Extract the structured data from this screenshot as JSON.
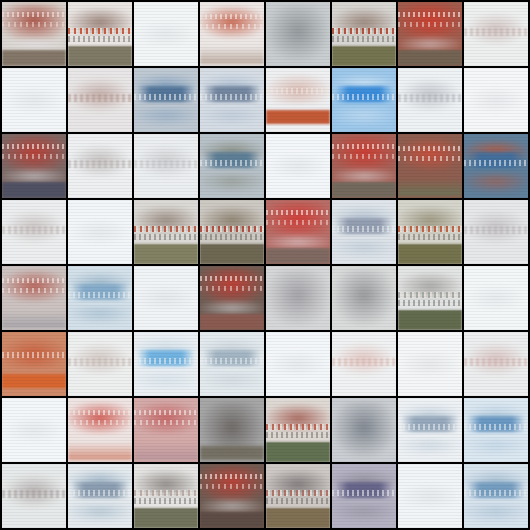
{
  "grid": {
    "rows": 8,
    "cols": 8,
    "tiles": [
      {
        "style": "red-dark",
        "bg": "#d9d4cf",
        "blob": "#a84c3e",
        "band": "#7b6d5e"
      },
      {
        "style": "strip",
        "bg": "#e9e5e2",
        "blob": "#8a6f64",
        "band": "#7a7560",
        "accent": "#c84a2e"
      },
      {
        "style": "white",
        "bg": "#f3f6f7"
      },
      {
        "style": "red",
        "bg": "#ece7e5",
        "blob": "#c5573e",
        "band": "#b9a89b"
      },
      {
        "style": "gray",
        "bg": "#c9ced0",
        "blob": "#8a8f93"
      },
      {
        "style": "strip",
        "bg": "#d8d6d2",
        "blob": "#8d766a",
        "band": "#6f6f4a",
        "accent": "#b23f2b"
      },
      {
        "style": "red-dark",
        "bg": "#9f5d4e",
        "blob": "#d03d2f",
        "band": "#6e6454"
      },
      {
        "style": "pale",
        "bg": "#eef0f0",
        "blob": "#c7b4b1"
      },
      {
        "style": "white",
        "bg": "#f2f6f8"
      },
      {
        "style": "pale",
        "bg": "#e8e6e6",
        "blob": "#b79a93"
      },
      {
        "style": "blue",
        "bg": "#bfc9d3",
        "blob": "#4b6f95",
        "band": "#8aa6c2"
      },
      {
        "style": "blue",
        "bg": "#d6dde5",
        "blob": "#6b7f9a",
        "band": "#b3c3d6"
      },
      {
        "style": "orange",
        "bg": "#eef0f2",
        "blob": "#d8b3a8",
        "band": "#c1522e"
      },
      {
        "style": "blue",
        "bg": "#9cc7ea",
        "blob": "#2f86d8",
        "band": "#cfe5f6"
      },
      {
        "style": "pale",
        "bg": "#eef2f4",
        "blob": "#b4b6bd"
      },
      {
        "style": "white",
        "bg": "#f5f7f8"
      },
      {
        "style": "red-dark",
        "bg": "#7c6a67",
        "blob": "#bf3c33",
        "band": "#4c4f63"
      },
      {
        "style": "pale",
        "bg": "#eef0f2",
        "blob": "#b7b1ae"
      },
      {
        "style": "pale",
        "bg": "#eceff1",
        "blob": "#c4c4c7"
      },
      {
        "style": "blue",
        "bg": "#b8c2c9",
        "blob": "#567a94",
        "band": "#8a8f84"
      },
      {
        "style": "white",
        "bg": "#f4f7f9"
      },
      {
        "style": "red-dark",
        "bg": "#a56359",
        "blob": "#cf3a30",
        "band": "#6e6a5e"
      },
      {
        "style": "red",
        "bg": "#8e5e50",
        "blob": "#cf4d3a",
        "band": "#6a765a"
      },
      {
        "style": "blue",
        "bg": "#5f7f9b",
        "blob": "#3e6fa0",
        "band": "#b55a40"
      },
      {
        "style": "pale",
        "bg": "#eceeef",
        "blob": "#c0b7b5"
      },
      {
        "style": "white",
        "bg": "#f3f6f8"
      },
      {
        "style": "strip",
        "bg": "#dcdad6",
        "blob": "#8d7d72",
        "band": "#7e7d5d",
        "accent": "#b9513b"
      },
      {
        "style": "strip",
        "bg": "#cdc9c3",
        "blob": "#7f735f",
        "band": "#69634d",
        "accent": "#b33f31"
      },
      {
        "style": "red-dark",
        "bg": "#b86f69",
        "blob": "#d33b35",
        "band": "#7a6961"
      },
      {
        "style": "blue",
        "bg": "#dfe5ea",
        "blob": "#8d98ad",
        "band": "#b6c4d3"
      },
      {
        "style": "strip",
        "bg": "#d6d5cc",
        "blob": "#8f8a70",
        "band": "#6f6e47",
        "accent": "#c25533"
      },
      {
        "style": "pale",
        "bg": "#e6e8ea",
        "blob": "#bcb7bb"
      },
      {
        "style": "red",
        "bg": "#ccc3c1",
        "blob": "#b4574c",
        "band": "#a4a1a8"
      },
      {
        "style": "blue",
        "bg": "#d4e1ea",
        "blob": "#7fa8c8",
        "band": "#9db8cc"
      },
      {
        "style": "white",
        "bg": "#f1f4f6"
      },
      {
        "style": "red-dark",
        "bg": "#6f5e55",
        "blob": "#c63d34",
        "band": "#8d5b51"
      },
      {
        "style": "gray",
        "bg": "#d6d7d8",
        "blob": "#9a9a9f"
      },
      {
        "style": "gray",
        "bg": "#dadcdc",
        "blob": "#8d8e91"
      },
      {
        "style": "strip",
        "bg": "#e3e5e4",
        "blob": "#9d9b98",
        "band": "#5d6547",
        "accent": "#a2a7a3"
      },
      {
        "style": "white",
        "bg": "#f4f7f8"
      },
      {
        "style": "orange",
        "bg": "#cf8a6a",
        "blob": "#c85a39",
        "band": "#d8642d"
      },
      {
        "style": "pale",
        "bg": "#eef0f0",
        "blob": "#c9bbb4"
      },
      {
        "style": "blue",
        "bg": "#eaf0f4",
        "blob": "#65aee0",
        "band": "#cfdce6"
      },
      {
        "style": "blue",
        "bg": "#e4ebef",
        "blob": "#9eb1c0",
        "band": "#c9d3da"
      },
      {
        "style": "white",
        "bg": "#f4f7f9"
      },
      {
        "style": "pale",
        "bg": "#f0f2f3",
        "blob": "#ddb9b2"
      },
      {
        "style": "white",
        "bg": "#f4f6f7"
      },
      {
        "style": "pale",
        "bg": "#eceeef",
        "blob": "#d2b4b0"
      },
      {
        "style": "white",
        "bg": "#f3f7f9"
      },
      {
        "style": "red",
        "bg": "#eee4e2",
        "blob": "#ce4c43",
        "band": "#d58b76"
      },
      {
        "style": "red",
        "bg": "#d4aba9",
        "blob": "#c45d5e",
        "band": "#b7949a"
      },
      {
        "style": "gray",
        "bg": "#a7a7a8",
        "blob": "#645f5c",
        "band": "#6b6555"
      },
      {
        "style": "strip",
        "bg": "#dfd9d4",
        "blob": "#9e5145",
        "band": "#5b6c4a",
        "accent": "#be5a48"
      },
      {
        "style": "gray",
        "bg": "#cbcfd3",
        "blob": "#747b85"
      },
      {
        "style": "blue",
        "bg": "#eef2f5",
        "blob": "#8fa3b8",
        "band": "#c2d0dc"
      },
      {
        "style": "blue",
        "bg": "#dce8f2",
        "blob": "#5f92bf",
        "band": "#b7cfdf"
      },
      {
        "style": "pale",
        "bg": "#e7eaea",
        "blob": "#a89f9f"
      },
      {
        "style": "blue",
        "bg": "#e5ebef",
        "blob": "#8598ad",
        "band": "#9fb5c7"
      },
      {
        "style": "strip",
        "bg": "#e6e5e3",
        "blob": "#7d7874",
        "band": "#6b6d55",
        "accent": "#b8a9a4"
      },
      {
        "style": "red-dark",
        "bg": "#6f5c53",
        "blob": "#c04136",
        "band": "#5d4c45"
      },
      {
        "style": "strip",
        "bg": "#cfc9c6",
        "blob": "#6e6a6a",
        "band": "#7b6b4d",
        "accent": "#ad6a5e"
      },
      {
        "style": "blue",
        "bg": "#b6b4c4",
        "blob": "#615f86",
        "band": "#918d9d"
      },
      {
        "style": "white",
        "bg": "#f2f5f7"
      },
      {
        "style": "blue",
        "bg": "#d8e4ee",
        "blob": "#6d98bd",
        "band": "#a6bfd2"
      }
    ]
  }
}
